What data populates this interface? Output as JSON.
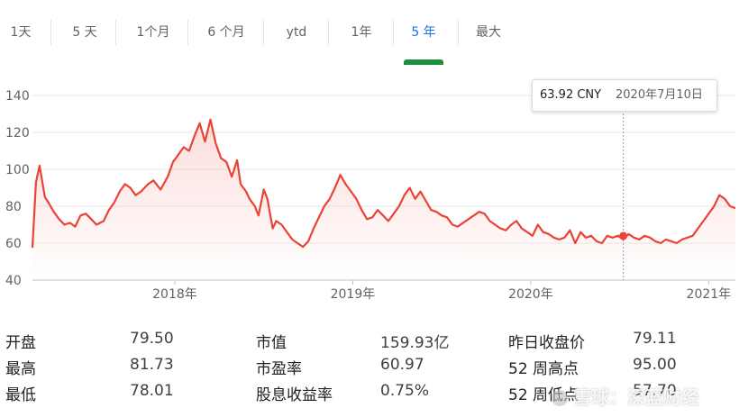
{
  "range_tabs": [
    "1天",
    "5 天",
    "1个月",
    "6 个月",
    "ytd",
    "1年",
    "5 年",
    "最大"
  ],
  "active_tab_index": 6,
  "tooltip": {
    "price": "63.92 CNY",
    "date": "2020年7月10日"
  },
  "colors": {
    "line": "#ea4335",
    "accent": "#1e8e3e",
    "grid": "#e8eaed"
  },
  "stats": {
    "open_label": "开盘",
    "open_value": "79.50",
    "high_label": "最高",
    "high_value": "81.73",
    "low_label": "最低",
    "low_value": "78.01",
    "mktcap_label": "市值",
    "mktcap_value": "159.93亿",
    "pe_label": "市盈率",
    "pe_value": "60.97",
    "div_label": "股息收益率",
    "div_value": "0.75%",
    "prev_close_label": "昨日收盘价",
    "prev_close_value": "79.11",
    "wk52_high_label": "52 周高点",
    "wk52_high_value": "95.00",
    "wk52_low_label": "52 周低点",
    "wk52_low_value": "57.70"
  },
  "watermark": "雪球：深蓝财经",
  "chart_data": {
    "type": "line",
    "unit": "CNY",
    "ylim": [
      40,
      140
    ],
    "y_ticks": [
      "140",
      "120",
      "100",
      "80",
      "60",
      "40"
    ],
    "x_ticks": [
      {
        "label": "2018年",
        "x": 2018.0
      },
      {
        "label": "2019年",
        "x": 2019.0
      },
      {
        "label": "2020年",
        "x": 2020.0
      },
      {
        "label": "2021年",
        "x": 2021.0
      }
    ],
    "xlim": [
      2017.2,
      2021.15
    ],
    "grid": true,
    "highlight": {
      "x": 2020.52,
      "y": 63.92
    },
    "series": [
      {
        "x": [
          2017.2,
          2017.22,
          2017.24,
          2017.27,
          2017.29,
          2017.32,
          2017.35,
          2017.38,
          2017.41,
          2017.44,
          2017.47,
          2017.5,
          2017.53,
          2017.56,
          2017.6,
          2017.63,
          2017.66,
          2017.69,
          2017.72,
          2017.75,
          2017.78,
          2017.81,
          2017.85,
          2017.88,
          2017.92,
          2017.96,
          2017.99,
          2018.02,
          2018.05,
          2018.08,
          2018.11,
          2018.14,
          2018.17,
          2018.2,
          2018.23,
          2018.26,
          2018.29,
          2018.32,
          2018.35,
          2018.37,
          2018.4,
          2018.42,
          2018.45,
          2018.47,
          2018.5,
          2018.52,
          2018.55,
          2018.57,
          2018.6,
          2018.63,
          2018.66,
          2018.69,
          2018.72,
          2018.75,
          2018.78,
          2018.81,
          2018.84,
          2018.87,
          2018.9,
          2018.93,
          2018.96,
          2018.99,
          2019.02,
          2019.05,
          2019.08,
          2019.11,
          2019.14,
          2019.17,
          2019.2,
          2019.23,
          2019.26,
          2019.29,
          2019.32,
          2019.35,
          2019.38,
          2019.41,
          2019.44,
          2019.47,
          2019.5,
          2019.53,
          2019.56,
          2019.59,
          2019.62,
          2019.65,
          2019.68,
          2019.71,
          2019.74,
          2019.77,
          2019.8,
          2019.83,
          2019.86,
          2019.89,
          2019.92,
          2019.95,
          2019.98,
          2020.01,
          2020.04,
          2020.07,
          2020.1,
          2020.13,
          2020.16,
          2020.19,
          2020.22,
          2020.25,
          2020.28,
          2020.31,
          2020.34,
          2020.37,
          2020.4,
          2020.43,
          2020.46,
          2020.49,
          2020.52,
          2020.55,
          2020.58,
          2020.61,
          2020.64,
          2020.67,
          2020.7,
          2020.73,
          2020.76,
          2020.79,
          2020.82,
          2020.85,
          2020.88,
          2020.91,
          2020.94,
          2020.97,
          2021.0,
          2021.03,
          2021.06,
          2021.09,
          2021.12,
          2021.15
        ],
        "y": [
          57.5,
          93,
          102,
          85,
          82,
          77,
          73,
          70,
          71,
          69,
          75,
          76,
          73,
          70,
          72,
          78,
          82,
          88,
          92,
          90,
          86,
          88,
          92,
          94,
          89,
          96,
          104,
          108,
          112,
          110,
          118,
          125,
          115,
          127,
          114,
          106,
          104,
          96,
          105,
          92,
          88,
          84,
          80,
          75,
          89,
          84,
          68,
          72,
          70,
          66,
          62,
          60,
          58,
          61,
          68,
          74,
          80,
          84,
          90,
          97,
          92,
          88,
          84,
          78,
          73,
          74,
          78,
          75,
          72,
          76,
          80,
          86,
          90,
          84,
          88,
          83,
          78,
          77,
          75,
          74,
          70,
          69,
          71,
          73,
          75,
          77,
          76,
          72,
          70,
          68,
          67,
          70,
          72,
          68,
          66,
          64,
          70,
          66,
          65,
          63,
          62,
          63,
          67,
          60,
          66,
          63,
          64,
          61,
          60,
          64,
          63,
          64,
          62,
          65,
          63,
          62,
          64,
          63,
          61,
          60,
          62,
          61,
          60,
          62,
          63,
          64,
          68,
          72,
          76,
          80,
          86,
          84,
          80,
          79
        ]
      }
    ]
  }
}
